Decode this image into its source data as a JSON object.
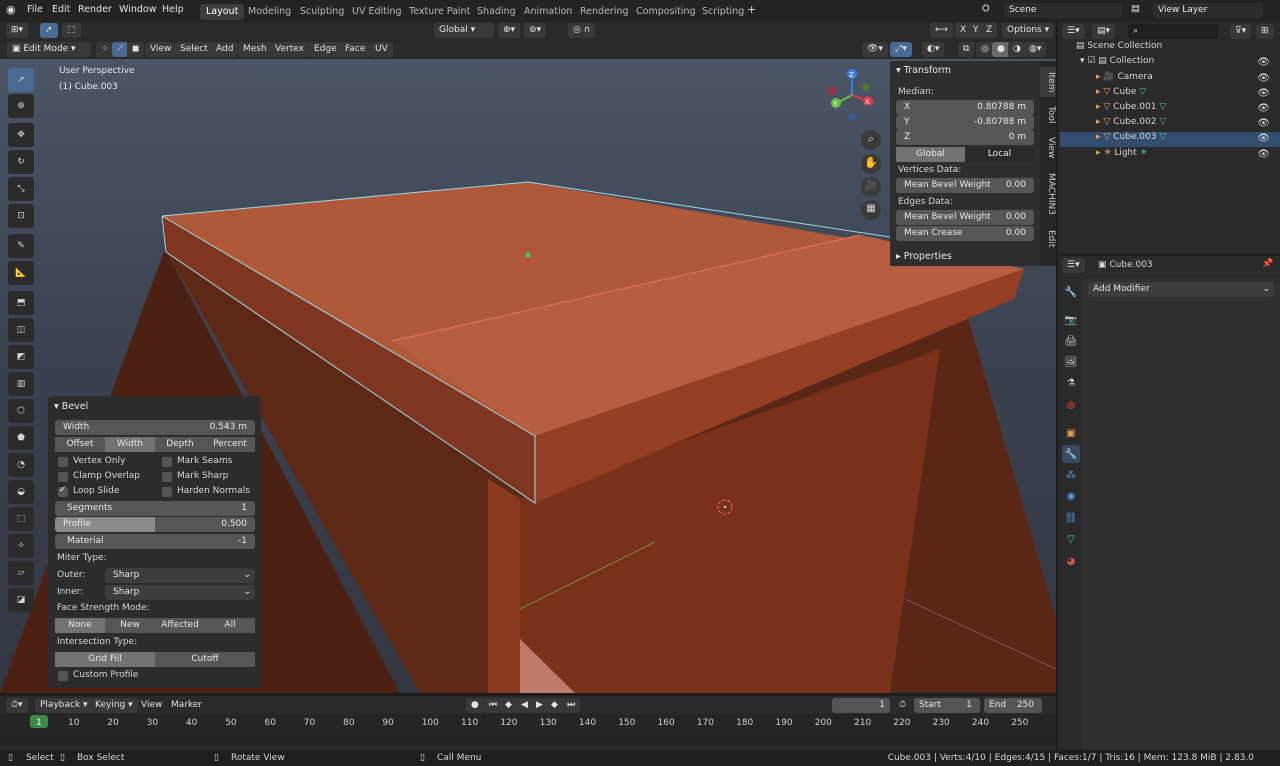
{
  "app": {
    "menus": [
      "File",
      "Edit",
      "Render",
      "Window",
      "Help"
    ],
    "workspaces": [
      "Layout",
      "Modeling",
      "Sculpting",
      "UV Editing",
      "Texture Paint",
      "Shading",
      "Animation",
      "Rendering",
      "Compositing",
      "Scripting"
    ],
    "active_workspace": "Layout",
    "scene": "Scene",
    "view_layer": "View Layer"
  },
  "toolbar": {
    "mode": "Edit Mode",
    "menus": [
      "View",
      "Select",
      "Add",
      "Mesh",
      "Vertex",
      "Edge",
      "Face",
      "UV"
    ],
    "orientation": "Global",
    "axes": [
      "X",
      "Y",
      "Z"
    ],
    "options": "Options"
  },
  "viewport": {
    "perspective": "User Perspective",
    "object": "(1) Cube.003"
  },
  "sidebar": {
    "tabs": [
      "Item",
      "Tool",
      "View",
      "MACHIN3",
      "Edit"
    ],
    "transform_title": "Transform",
    "median_label": "Median:",
    "x_label": "X",
    "x_value": "0.80788 m",
    "y_label": "Y",
    "y_value": "-0.80788 m",
    "z_label": "Z",
    "z_value": "0 m",
    "global": "Global",
    "local": "Local",
    "vertices_data": "Vertices Data:",
    "mean_bevel_weight_label": "Mean Bevel Weight",
    "vert_bevel_weight": "0.00",
    "edges_data": "Edges Data:",
    "edge_bevel_weight": "0.00",
    "mean_crease_label": "Mean Crease",
    "mean_crease": "0.00",
    "properties": "Properties"
  },
  "bevel": {
    "title": "Bevel",
    "width_label": "Width",
    "width_value": "0.543 m",
    "width_types": [
      "Offset",
      "Width",
      "Depth",
      "Percent"
    ],
    "active_width_type": "Width",
    "options_left": [
      {
        "label": "Vertex Only",
        "checked": false
      },
      {
        "label": "Clamp Overlap",
        "checked": false
      },
      {
        "label": "Loop Slide",
        "checked": true
      }
    ],
    "options_right": [
      {
        "label": "Mark Seams",
        "checked": false
      },
      {
        "label": "Mark Sharp",
        "checked": false
      },
      {
        "label": "Harden Normals",
        "checked": false
      }
    ],
    "segments_label": "Segments",
    "segments": "1",
    "profile_label": "Profile",
    "profile": "0.500",
    "profile_fraction": 0.5,
    "material_label": "Material",
    "material": "-1",
    "miter_type": "Miter Type:",
    "outer_label": "Outer:",
    "outer": "Sharp",
    "inner_label": "Inner:",
    "inner": "Sharp",
    "face_strength": "Face Strength Mode:",
    "face_modes": [
      "None",
      "New",
      "Affected",
      "All"
    ],
    "active_face_mode": "None",
    "intersection": "Intersection Type:",
    "intersection_modes": [
      "Grid Fill",
      "Cutoff"
    ],
    "active_intersection": "Grid Fill",
    "custom_profile": "Custom Profile"
  },
  "outliner": {
    "root": "Scene Collection",
    "collection": "Collection",
    "items": [
      "Camera",
      "Cube",
      "Cube.001",
      "Cube.002",
      "Cube.003",
      "Light"
    ],
    "selected": "Cube.003"
  },
  "properties": {
    "object": "Cube.003",
    "add_modifier": "Add Modifier"
  },
  "timeline": {
    "menus": [
      "Playback",
      "Keying",
      "View",
      "Marker"
    ],
    "current_frame": "1",
    "start_label": "Start",
    "start": "1",
    "end_label": "End",
    "end": "250",
    "ticks": [
      "1",
      "10",
      "20",
      "30",
      "40",
      "50",
      "60",
      "70",
      "80",
      "90",
      "100",
      "110",
      "120",
      "130",
      "140",
      "150",
      "160",
      "170",
      "180",
      "190",
      "200",
      "210",
      "220",
      "230",
      "240",
      "250"
    ]
  },
  "status": {
    "select": "Select",
    "box_select": "Box Select",
    "rotate_view": "Rotate View",
    "call_menu": "Call Menu",
    "stats": "Cube.003 | Verts:4/10 | Edges:4/15 | Faces:1/7 | Tris:16 | Mem: 123.8 MiB | 2.83.0"
  },
  "colors": {
    "accent": "#4a6a93",
    "mesh": "#b0583a",
    "selected_row": "#334d70"
  }
}
